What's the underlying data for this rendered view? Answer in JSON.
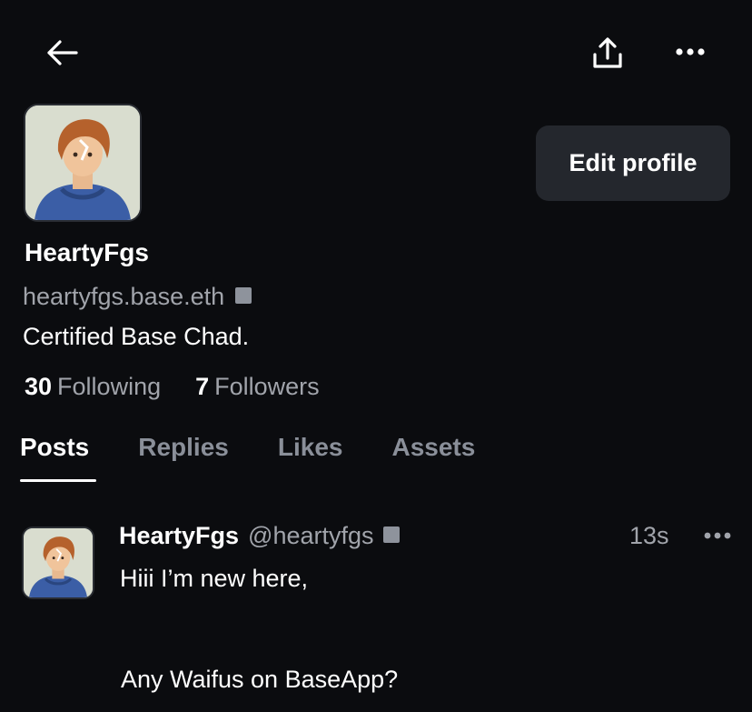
{
  "header": {
    "back_icon": "arrow-left-icon",
    "share_icon": "share-upload-icon",
    "more_icon": "more-horizontal-icon"
  },
  "profile": {
    "display_name": "HeartyFgs",
    "handle": "heartyfgs.base.eth",
    "bio": "Certified Base Chad.",
    "following_count": "30",
    "following_label": "Following",
    "followers_count": "7",
    "followers_label": "Followers",
    "edit_button_label": "Edit profile"
  },
  "tabs": [
    {
      "label": "Posts",
      "active": true
    },
    {
      "label": "Replies",
      "active": false
    },
    {
      "label": "Likes",
      "active": false
    },
    {
      "label": "Assets",
      "active": false
    }
  ],
  "post": {
    "author_name": "HeartyFgs",
    "author_handle": "@heartyfgs",
    "time": "13s",
    "text_line1": "Hiii I’m new here,",
    "text_line2": "Any Waifus on BaseApp?"
  },
  "colors": {
    "background": "#0b0c0f",
    "muted_text": "#a1a4ab",
    "button_bg": "#24272d"
  }
}
